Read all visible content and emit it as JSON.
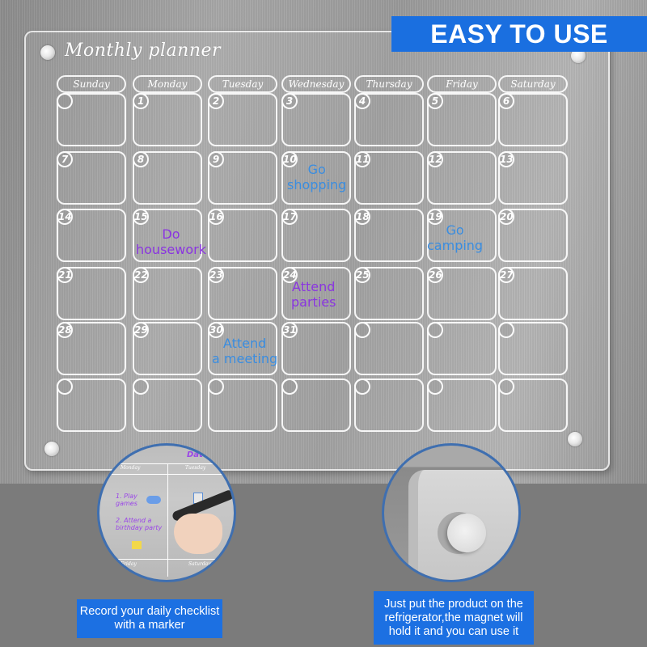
{
  "banner": {
    "label": "EASY TO USE",
    "color": "#1a6fe0"
  },
  "planner": {
    "title": "Monthly planner",
    "weekdays": [
      "Sunday",
      "Monday",
      "Tuesday",
      "Wednesday",
      "Thursday",
      "Friday",
      "Saturday"
    ],
    "weeks": [
      [
        "",
        "1",
        "2",
        "3",
        "4",
        "5",
        "6"
      ],
      [
        "7",
        "8",
        "9",
        "10",
        "11",
        "12",
        "13"
      ],
      [
        "14",
        "15",
        "16",
        "17",
        "18",
        "19",
        "20"
      ],
      [
        "21",
        "22",
        "23",
        "24",
        "25",
        "26",
        "27"
      ],
      [
        "28",
        "29",
        "30",
        "31",
        "",
        "",
        ""
      ],
      [
        "",
        "",
        "",
        "",
        "",
        "",
        ""
      ]
    ],
    "notes": [
      {
        "day": "10",
        "text_line1": "Go",
        "text_line2": "shopping",
        "color": "#3a8de0"
      },
      {
        "day": "15",
        "text_line1": "Do",
        "text_line2": "housework",
        "color": "#8a35e0"
      },
      {
        "day": "19",
        "text_line1": "Go",
        "text_line2": "camping",
        "color": "#3a8de0"
      },
      {
        "day": "24",
        "text_line1": "Attend",
        "text_line2": "parties",
        "color": "#8a35e0"
      },
      {
        "day": "30",
        "text_line1": "Attend",
        "text_line2": "a meeting",
        "color": "#3a8de0"
      }
    ]
  },
  "detail_left": {
    "header_label": "Date",
    "day_labels": [
      "Monday",
      "Tuesday",
      "Friday",
      "Saturday"
    ],
    "items": [
      "1. Play games",
      "2. Attend a birthday party"
    ],
    "caption": "Record your daily checklist with a marker"
  },
  "detail_right": {
    "caption": "Just put the product on the refrigerator,the magnet will hold it and you can use it"
  }
}
